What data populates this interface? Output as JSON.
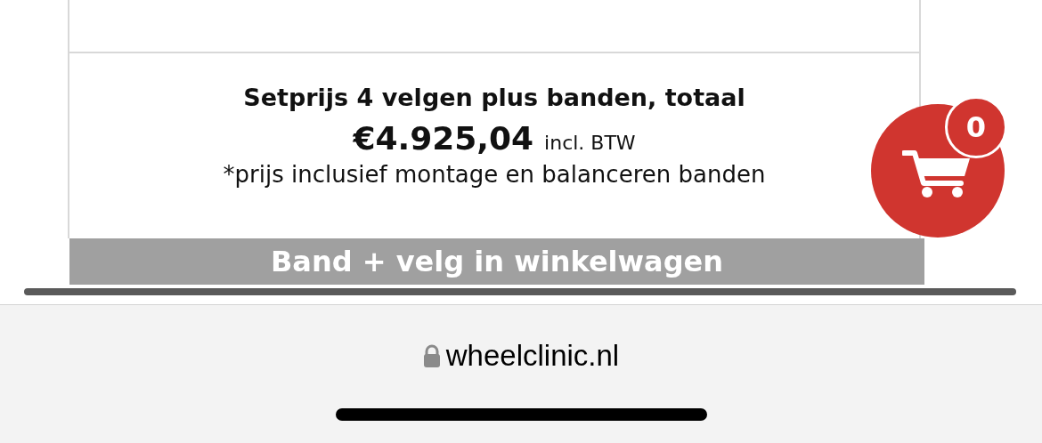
{
  "product": {
    "set_title": "Setprijs 4 velgen plus banden, totaal",
    "price": "€4.925,04",
    "price_note": "incl. BTW",
    "footnote": "*prijs inclusief montage en balanceren banden"
  },
  "cart_button": {
    "label": "Band + velg in winkelwagen"
  },
  "cart": {
    "count": "0"
  },
  "browser": {
    "url": "wheelclinic.nl",
    "secure": true
  }
}
